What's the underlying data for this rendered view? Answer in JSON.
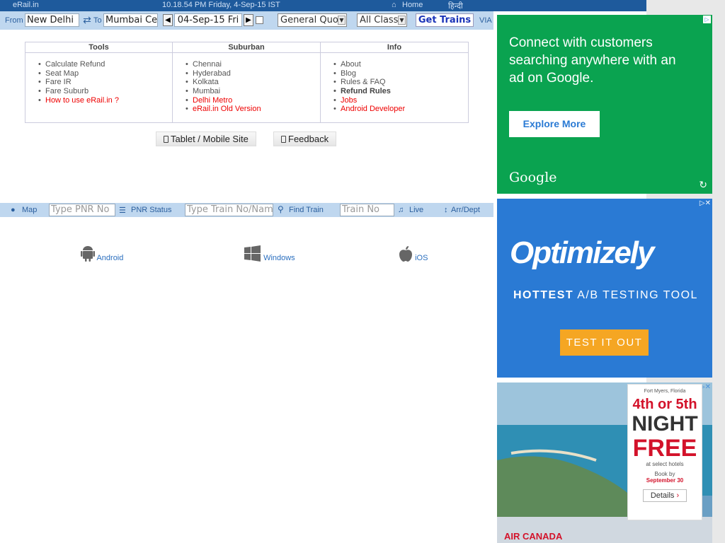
{
  "topbar": {
    "site": "eRail.in",
    "datetime": "10.18.54 PM Friday, 4-Sep-15 IST",
    "home": "Home",
    "hindi": "हिन्दी"
  },
  "search": {
    "from_label": "From",
    "from_value": "New Delhi",
    "to_label": "To",
    "to_value": "Mumbai Cer",
    "date_value": "04-Sep-15 Fri",
    "quota_value": "General Quot",
    "class_value": "All Class",
    "get_trains": "Get Trains",
    "via": "VIA"
  },
  "links": {
    "tools": {
      "heading": "Tools",
      "items": [
        "Calculate Refund",
        "Seat Map",
        "Fare IR",
        "Fare Suburb",
        "How to use eRail.in ?"
      ]
    },
    "suburban": {
      "heading": "Suburban",
      "items": [
        "Chennai",
        "Hyderabad",
        "Kolkata",
        "Mumbai",
        "Delhi Metro",
        "eRail.in Old Version"
      ]
    },
    "info": {
      "heading": "Info",
      "items": [
        "About",
        "Blog",
        "Rules & FAQ",
        "Refund Rules",
        "Jobs",
        "Android Developer"
      ]
    }
  },
  "buttons": {
    "tablet": "Tablet / Mobile Site",
    "feedback": "Feedback"
  },
  "toolbar": {
    "map": "Map",
    "pnr_placeholder": "Type PNR No",
    "pnr_status": "PNR Status",
    "train_placeholder": "Type Train No/Name",
    "find_train": "Find Train",
    "train_no_placeholder": "Train No",
    "live": "Live",
    "arrdept": "Arr/Dept"
  },
  "apps": {
    "android": "Android",
    "windows": "Windows",
    "ios": "iOS"
  },
  "ads": {
    "google": {
      "text": "Connect with customers searching anywhere with an ad on Google.",
      "button": "Explore More",
      "brand": "Google"
    },
    "optimizely": {
      "brand": "Optimizely",
      "tagline_bold": "HOTTEST",
      "tagline": "A/B TESTING TOOL",
      "button": "TEST IT OUT"
    },
    "aircanada": {
      "location": "Fort Myers, Florida",
      "offer_line1": "4th or 5th",
      "offer_night": "NIGHT",
      "offer_free": "FREE",
      "sub": "at select hotels",
      "book_by": "Book by",
      "date": "September 30",
      "details": "Details",
      "brand": "AIR CANADA"
    }
  }
}
